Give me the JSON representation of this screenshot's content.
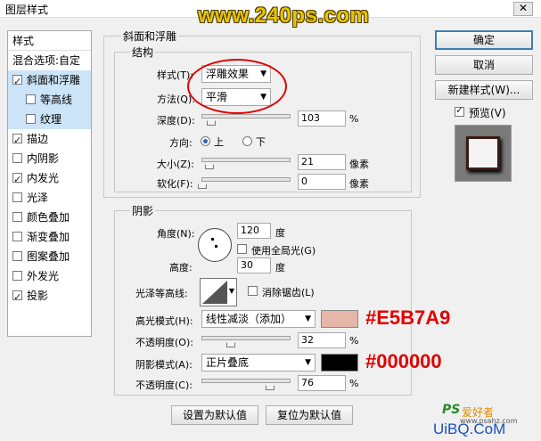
{
  "window": {
    "title": "图层样式",
    "close_glyph": "✕"
  },
  "watermark": "www.240ps.com",
  "left_panel": {
    "header": "样式",
    "blend": "混合选项:自定",
    "items": [
      {
        "label": "斜面和浮雕",
        "checked": true,
        "selected": true
      },
      {
        "label": "等高线",
        "checked": false,
        "selected": true,
        "sub": true
      },
      {
        "label": "纹理",
        "checked": false,
        "selected": true,
        "sub": true
      },
      {
        "label": "描边",
        "checked": true
      },
      {
        "label": "内阴影",
        "checked": false
      },
      {
        "label": "内发光",
        "checked": true
      },
      {
        "label": "光泽",
        "checked": false
      },
      {
        "label": "颜色叠加",
        "checked": false
      },
      {
        "label": "渐变叠加",
        "checked": false
      },
      {
        "label": "图案叠加",
        "checked": false
      },
      {
        "label": "外发光",
        "checked": false
      },
      {
        "label": "投影",
        "checked": true
      }
    ]
  },
  "bevel": {
    "group_title": "斜面和浮雕",
    "structure_title": "结构",
    "style_label": "样式(T):",
    "style_value": "浮雕效果",
    "technique_label": "方法(Q):",
    "technique_value": "平滑",
    "depth_label": "深度(D):",
    "depth_value": "103",
    "depth_unit": "%",
    "direction_label": "方向:",
    "dir_up": "上",
    "dir_down": "下",
    "size_label": "大小(Z):",
    "size_value": "21",
    "size_unit": "像素",
    "soften_label": "软化(F):",
    "soften_value": "0",
    "soften_unit": "像素"
  },
  "shading": {
    "title": "阴影",
    "angle_label": "角度(N):",
    "angle_value": "120",
    "angle_unit": "度",
    "global_light": "使用全局光(G)",
    "altitude_label": "高度:",
    "altitude_value": "30",
    "altitude_unit": "度",
    "gloss_label": "光泽等高线:",
    "anti_alias": "消除锯齿(L)",
    "highlight_label": "高光模式(H):",
    "highlight_mode": "线性减淡（添加）",
    "highlight_color": "#E5B7A9",
    "highlight_hex": "#E5B7A9",
    "highlight_opacity_label": "不透明度(O):",
    "highlight_opacity": "32",
    "opacity_unit": "%",
    "shadow_label": "阴影模式(A):",
    "shadow_mode": "正片叠底",
    "shadow_color": "#000000",
    "shadow_hex": "#000000",
    "shadow_opacity_label": "不透明度(C):",
    "shadow_opacity": "76"
  },
  "buttons": {
    "set_default": "设置为默认值",
    "reset_default": "复位为默认值",
    "ok": "确定",
    "cancel": "取消",
    "new_style": "新建样式(W)...",
    "preview": "预览(V)"
  },
  "sliders": {
    "depth": 0.1,
    "size": 0.08,
    "soften": 0.0,
    "highlight_opacity": 0.32,
    "shadow_opacity": 0.76
  },
  "corner_logo": {
    "ps": "PS",
    "cn": "爱好者",
    "url": "www.psahz.com",
    "brand": "UiBQ.CoM"
  }
}
